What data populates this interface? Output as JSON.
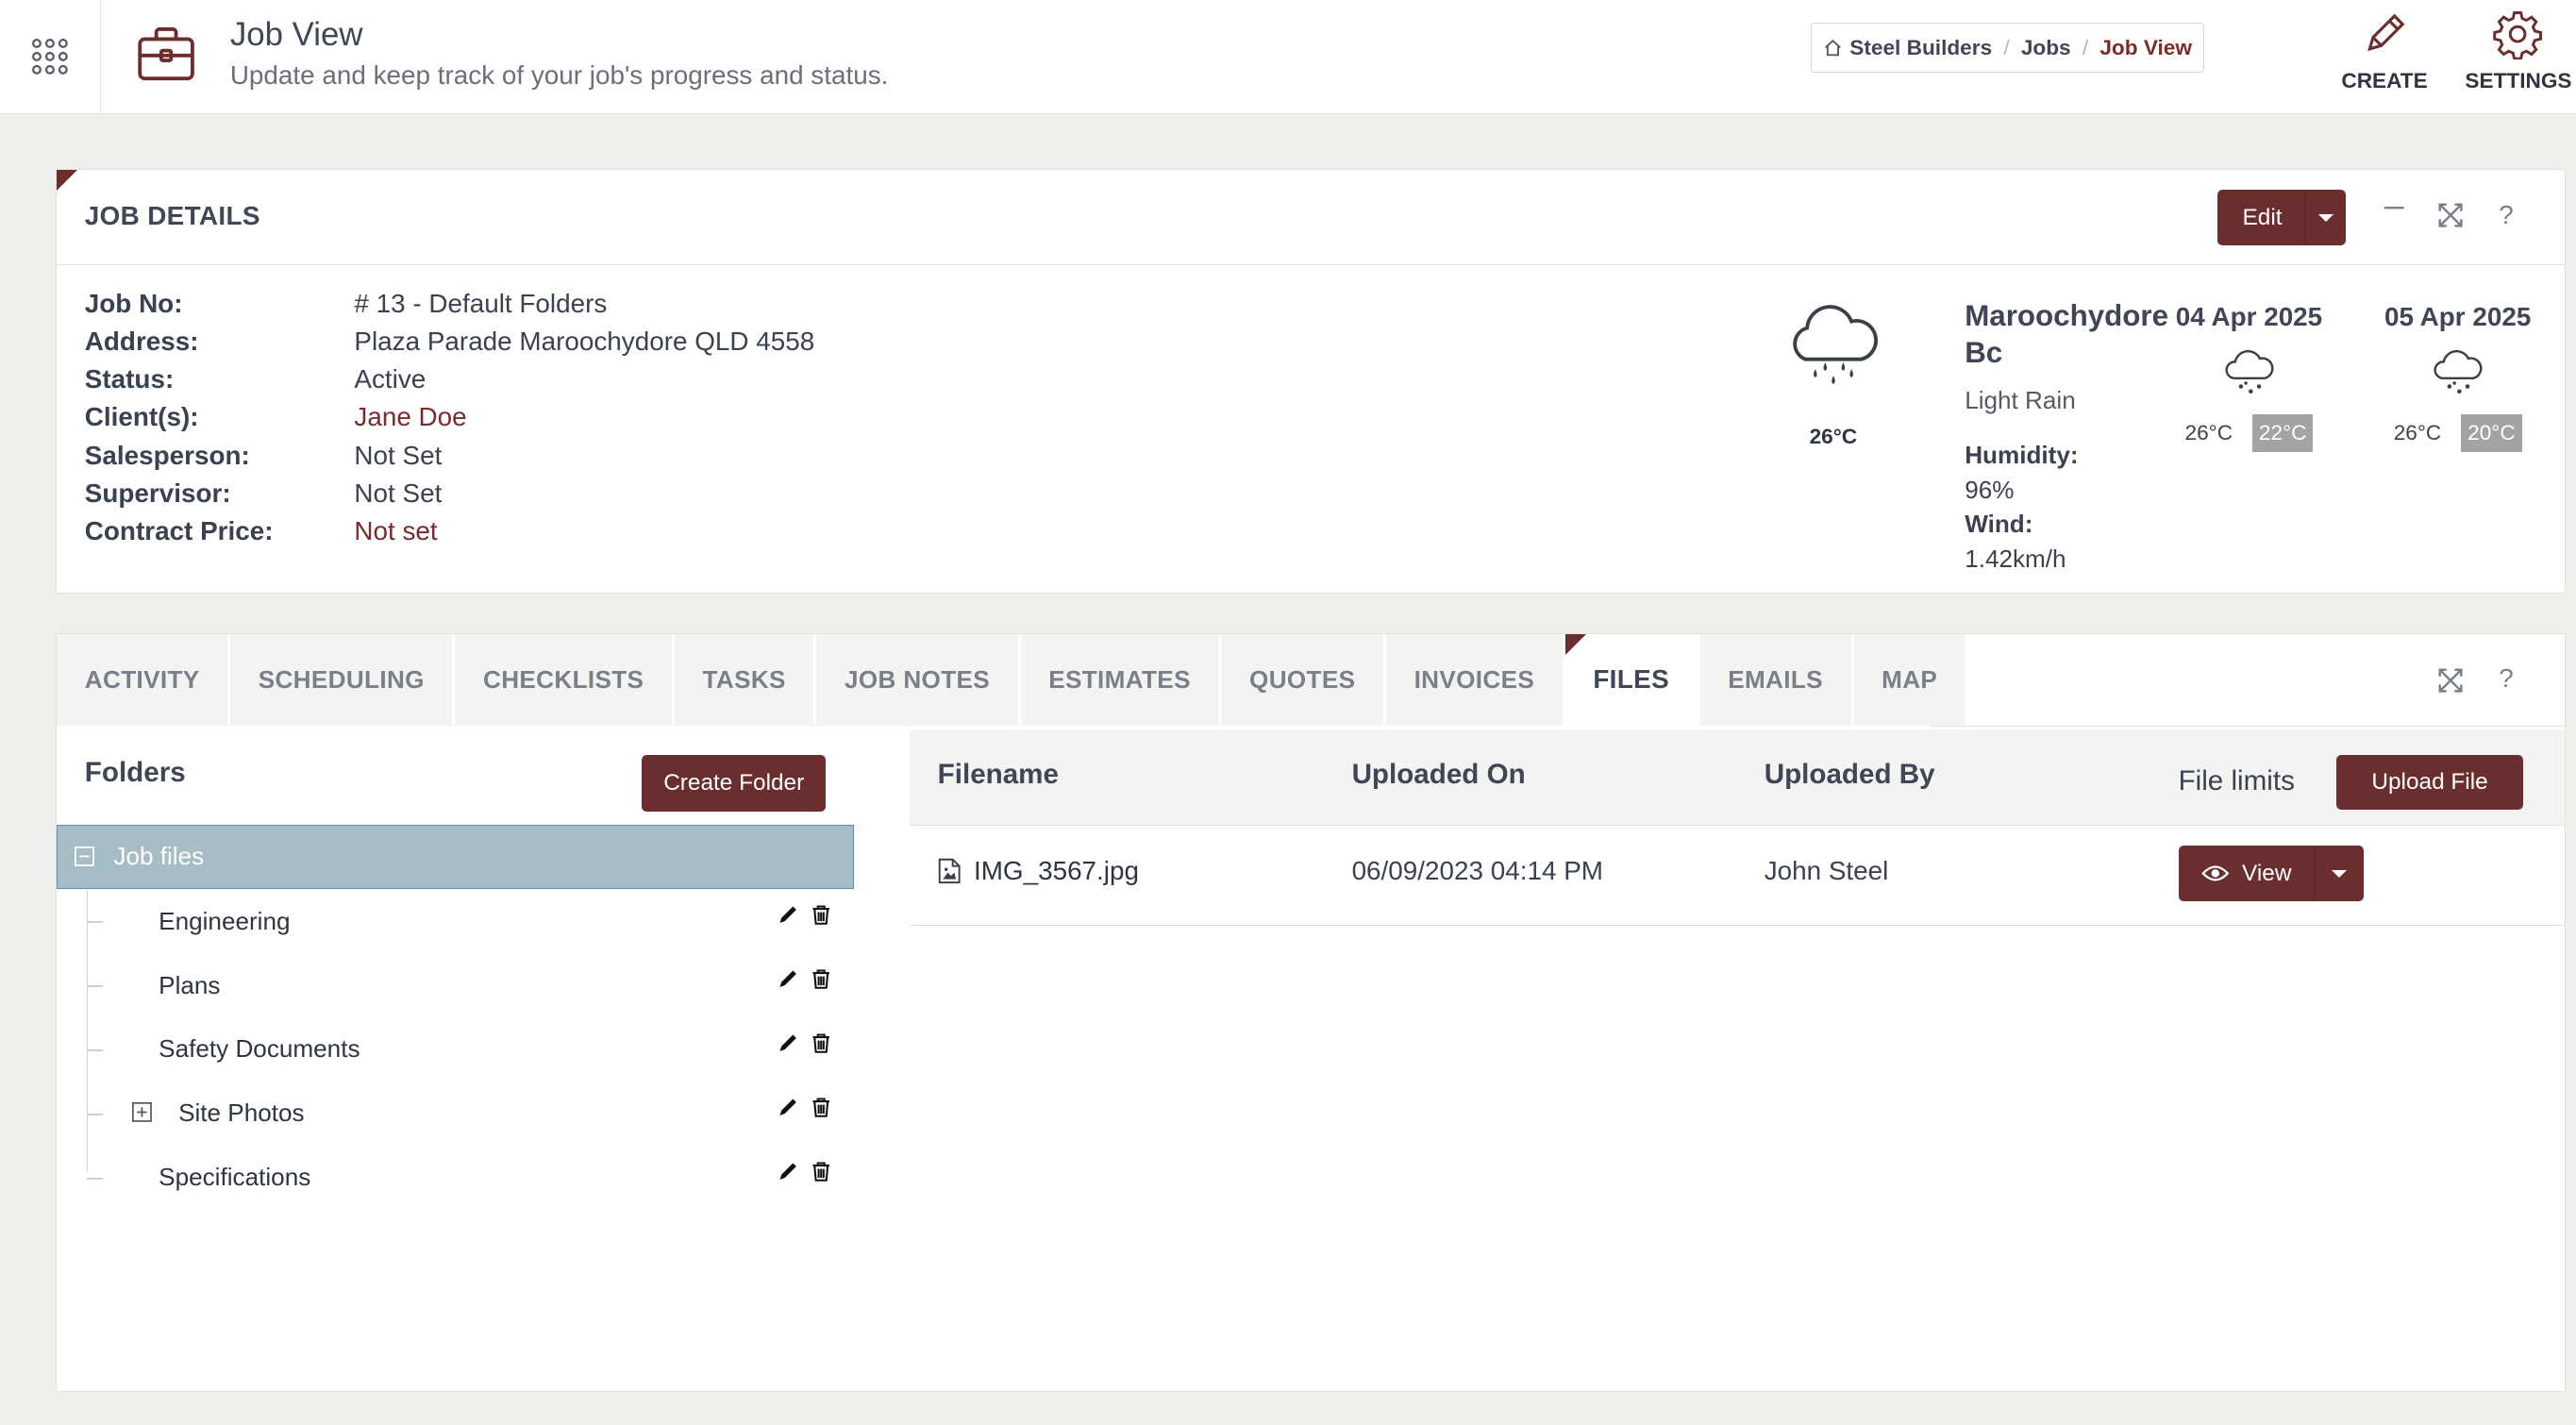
{
  "header": {
    "title": "Job View",
    "subtitle": "Update and keep track of your job's progress and status.",
    "breadcrumb": [
      "Steel Builders",
      "Jobs",
      "Job View"
    ],
    "actions": {
      "create": "CREATE",
      "settings": "SETTINGS"
    }
  },
  "job_details": {
    "title": "JOB DETAILS",
    "edit_label": "Edit",
    "fields": [
      {
        "label": "Job No:",
        "value": "# 13 - Default Folders"
      },
      {
        "label": "Address:",
        "value": "Plaza Parade Maroochydore QLD 4558"
      },
      {
        "label": "Status:",
        "value": "Active"
      },
      {
        "label": "Client(s):",
        "value": "Jane Doe"
      },
      {
        "label": "Salesperson:",
        "value": "Not Set"
      },
      {
        "label": "Supervisor:",
        "value": "Not Set"
      },
      {
        "label": "Contract Price:",
        "value": "Not set"
      }
    ]
  },
  "weather": {
    "current_temp": "26°C",
    "location_line1": "Maroochydore",
    "location_line2": "Bc",
    "description": "Light Rain",
    "humidity_label": "Humidity:",
    "humidity": "96%",
    "wind_label": "Wind:",
    "wind": "1.42km/h",
    "forecast": [
      {
        "date": "04 Apr 2025",
        "high": "26°C",
        "low": "22°C"
      },
      {
        "date": "05 Apr 2025",
        "high": "26°C",
        "low": "20°C"
      }
    ]
  },
  "tabs": [
    "ACTIVITY",
    "SCHEDULING",
    "CHECKLISTS",
    "TASKS",
    "JOB NOTES",
    "ESTIMATES",
    "QUOTES",
    "INVOICES",
    "FILES",
    "EMAILS",
    "MAP"
  ],
  "active_tab": "FILES",
  "folders": {
    "title": "Folders",
    "create_label": "Create Folder",
    "root": "Job files",
    "items": [
      "Engineering",
      "Plans",
      "Safety Documents",
      "Site Photos",
      "Specifications"
    ]
  },
  "files": {
    "columns": [
      "Filename",
      "Uploaded On",
      "Uploaded By"
    ],
    "limits_label": "File limits",
    "upload_label": "Upload File",
    "rows": [
      {
        "filename": "IMG_3567.jpg",
        "uploaded_on": "06/09/2023 04:14 PM",
        "uploaded_by": "John Steel",
        "action": "View"
      }
    ]
  },
  "colors": {
    "accent": "#6b2e2e",
    "selected_folder": "#a7bdc6",
    "page_bg": "#f0efeb"
  }
}
